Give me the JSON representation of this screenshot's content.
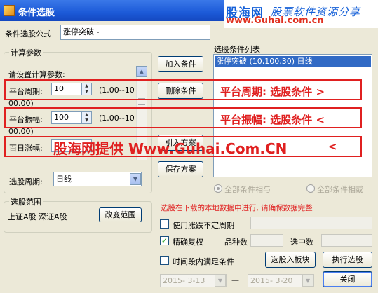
{
  "window": {
    "title": "条件选股"
  },
  "watermark": {
    "line1_brand": "股海网",
    "line1_tagline": "股票软件资源分享",
    "line2": "www.Guhai.com.cn"
  },
  "formula": {
    "label": "条件选股公式",
    "value": "涨停突破 -"
  },
  "calc_params": {
    "group_label": "计算参数",
    "instruction": "请设置计算参数:",
    "params": [
      {
        "label": "平台周期:",
        "value": "10",
        "range": "(1.00--10",
        "range2": "00.00)"
      },
      {
        "label": "平台振幅:",
        "value": "100",
        "range": "(1.00--10",
        "range2": "00.00)"
      },
      {
        "label": "百日涨幅:",
        "value": "",
        "range": "",
        "range2": ""
      }
    ]
  },
  "period": {
    "label": "选股周期:",
    "value": "日线"
  },
  "scope": {
    "group_label": "选股范围",
    "value": "上证A股 深证A股",
    "change_button": "改变范围"
  },
  "buttons": {
    "add": "加入条件",
    "delete": "删除条件",
    "import": "引入方案",
    "save": "保存方案",
    "to_block": "选股入板块",
    "run": "执行选股",
    "close": "关闭"
  },
  "conditions": {
    "label": "选股条件列表",
    "items": [
      "涨停突破 (10,100,30) 日线"
    ]
  },
  "logic": {
    "all_and": "全部条件相与",
    "all_or": "全部条件相或"
  },
  "notice": "选股在下载的本地数据中进行, 请确保数据完整",
  "options": {
    "use_adj_period": "使用涨跌不定周期",
    "precise_adjust": "精确复权",
    "variety_count_label": "品种数",
    "selected_count_label": "选中数",
    "time_range": "时间段内满足条件"
  },
  "dates": {
    "start": "2015- 3-13",
    "separator": "—",
    "end": "2015- 3-20"
  },
  "annotations": {
    "note1": "平台周期: 选股条件 >",
    "note2": "平台振幅: 选股条件 <",
    "note3": "股海网提供 Www.Guhai.Com.CN",
    "note3_tail": "<"
  },
  "colors": {
    "title_bar": "#1c5ad8",
    "annotation_red": "#e02020",
    "watermark_blue": "#1560d8",
    "selection": "#316ac5",
    "check_green": "#21a121"
  },
  "icons": [
    "app-icon",
    "spin-up-icon",
    "spin-down-icon",
    "dropdown-arrow-icon",
    "scroll-up-icon",
    "checkmark-icon"
  ]
}
